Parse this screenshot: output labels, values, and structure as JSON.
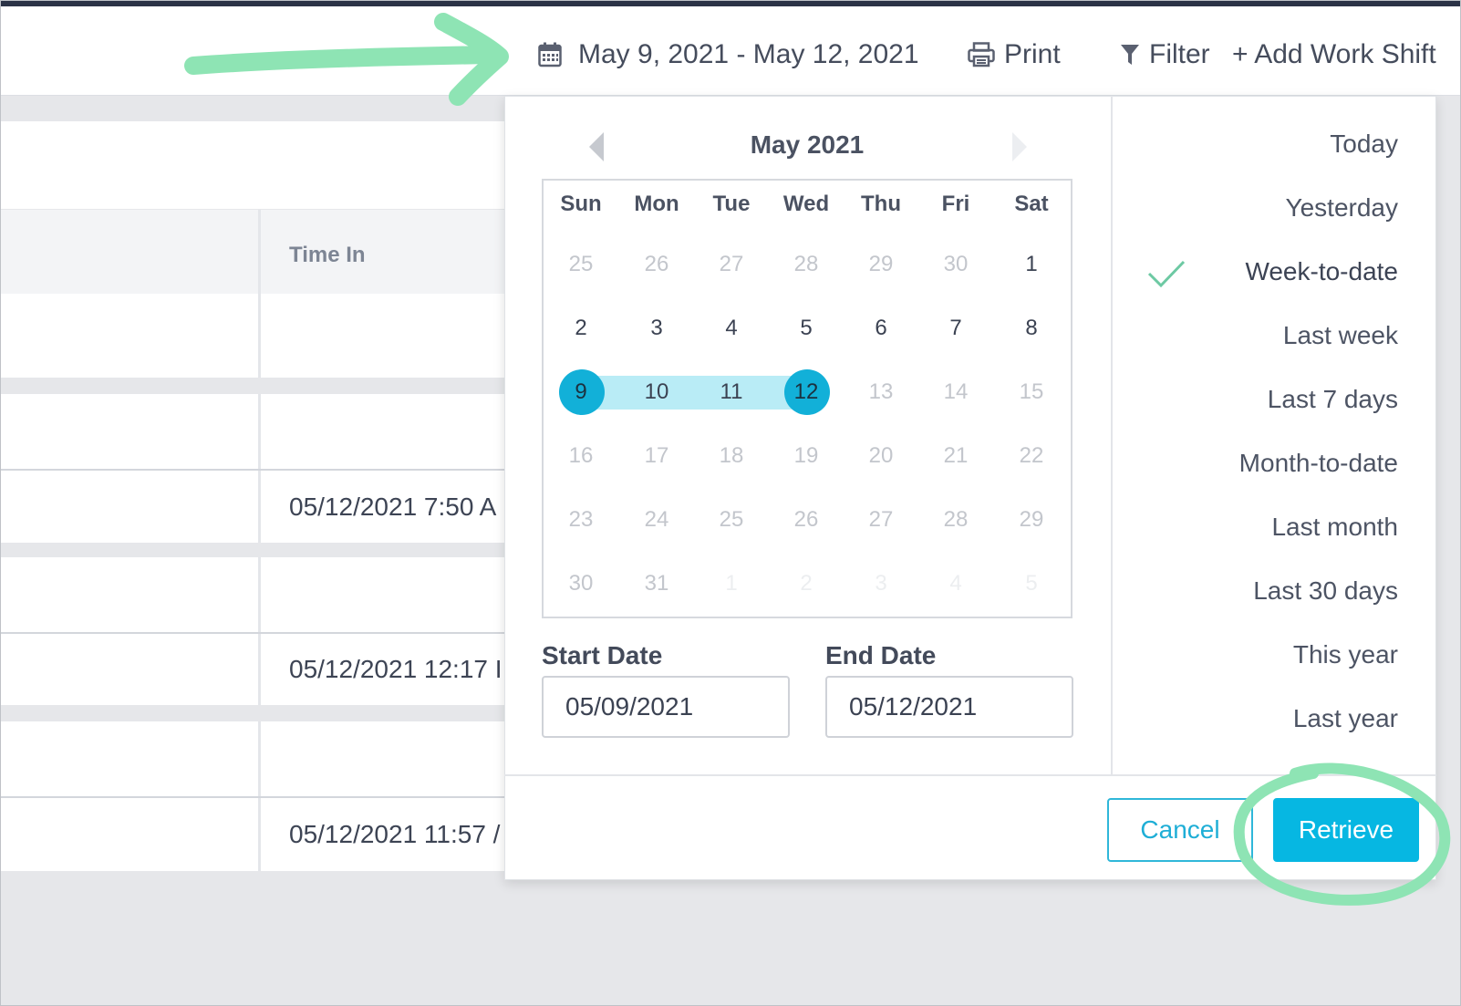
{
  "toolbar": {
    "date_range": "May 9, 2021 - May 12, 2021",
    "print_label": "Print",
    "filter_label": "Filter",
    "add_shift_label": "+ Add Work Shift"
  },
  "table": {
    "col_time_in": "Time In",
    "rows": [
      "05/12/2021 7:50 A",
      "05/12/2021 12:17 I",
      "05/12/2021 11:57 /"
    ]
  },
  "calendar": {
    "title": "May 2021",
    "weekdays": [
      "Sun",
      "Mon",
      "Tue",
      "Wed",
      "Thu",
      "Fri",
      "Sat"
    ],
    "weeks": [
      [
        "25",
        "26",
        "27",
        "28",
        "29",
        "30",
        "1"
      ],
      [
        "2",
        "3",
        "4",
        "5",
        "6",
        "7",
        "8"
      ],
      [
        "9",
        "10",
        "11",
        "12",
        "13",
        "14",
        "15"
      ],
      [
        "16",
        "17",
        "18",
        "19",
        "20",
        "21",
        "22"
      ],
      [
        "23",
        "24",
        "25",
        "26",
        "27",
        "28",
        "29"
      ],
      [
        "30",
        "31",
        "1",
        "2",
        "3",
        "4",
        "5"
      ]
    ]
  },
  "start_date": {
    "label": "Start Date",
    "value": "05/09/2021"
  },
  "end_date": {
    "label": "End Date",
    "value": "05/12/2021"
  },
  "presets": [
    "Today",
    "Yesterday",
    "Week-to-date",
    "Last week",
    "Last 7 days",
    "Month-to-date",
    "Last month",
    "Last 30 days",
    "This year",
    "Last year"
  ],
  "active_preset": "Week-to-date",
  "buttons": {
    "cancel": "Cancel",
    "retrieve": "Retrieve"
  },
  "colors": {
    "accent": "#06b7e2",
    "range": "#b9ecf6",
    "annotation": "#8ee4b4"
  }
}
